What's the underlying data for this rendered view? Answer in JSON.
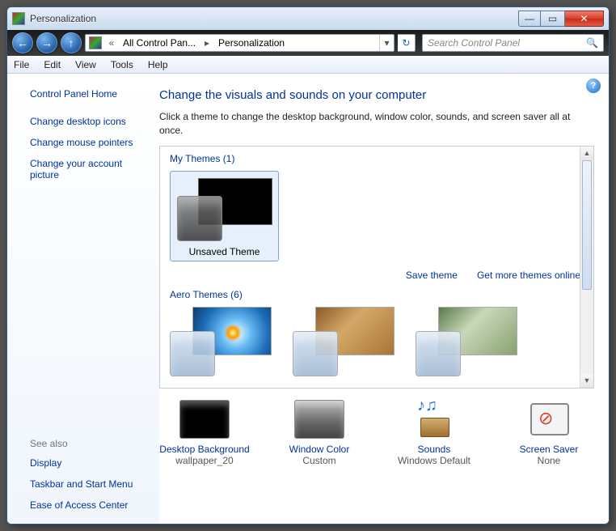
{
  "window": {
    "title": "Personalization"
  },
  "winbtns": {
    "min": "—",
    "max": "▭",
    "close": "✕"
  },
  "nav": {
    "back": "←",
    "fwd": "→",
    "up": "↑",
    "chev": "«",
    "seg1": "All Control Pan...",
    "arrow": "▸",
    "seg2": "Personalization",
    "drop": "▾",
    "refresh": "↻"
  },
  "search": {
    "placeholder": "Search Control Panel",
    "icon": "🔍"
  },
  "menu": {
    "file": "File",
    "edit": "Edit",
    "view": "View",
    "tools": "Tools",
    "help": "Help"
  },
  "sidebar": {
    "home": "Control Panel Home",
    "l1": "Change desktop icons",
    "l2": "Change mouse pointers",
    "l3": "Change your account picture",
    "see": "See also",
    "s1": "Display",
    "s2": "Taskbar and Start Menu",
    "s3": "Ease of Access Center"
  },
  "help": "?",
  "main": {
    "heading": "Change the visuals and sounds on your computer",
    "sub": "Click a theme to change the desktop background, window color, sounds, and screen saver all at once.",
    "my_hdr": "My Themes (1)",
    "theme1": "Unsaved Theme",
    "save": "Save theme",
    "more": "Get more themes online",
    "aero_hdr": "Aero Themes (6)",
    "scroll_up": "▲",
    "scroll_dn": "▼"
  },
  "bottom": {
    "bg": {
      "label": "Desktop Background",
      "value": "wallpaper_20"
    },
    "color": {
      "label": "Window Color",
      "value": "Custom"
    },
    "sound": {
      "label": "Sounds",
      "value": "Windows Default"
    },
    "saver": {
      "label": "Screen Saver",
      "value": "None"
    }
  }
}
